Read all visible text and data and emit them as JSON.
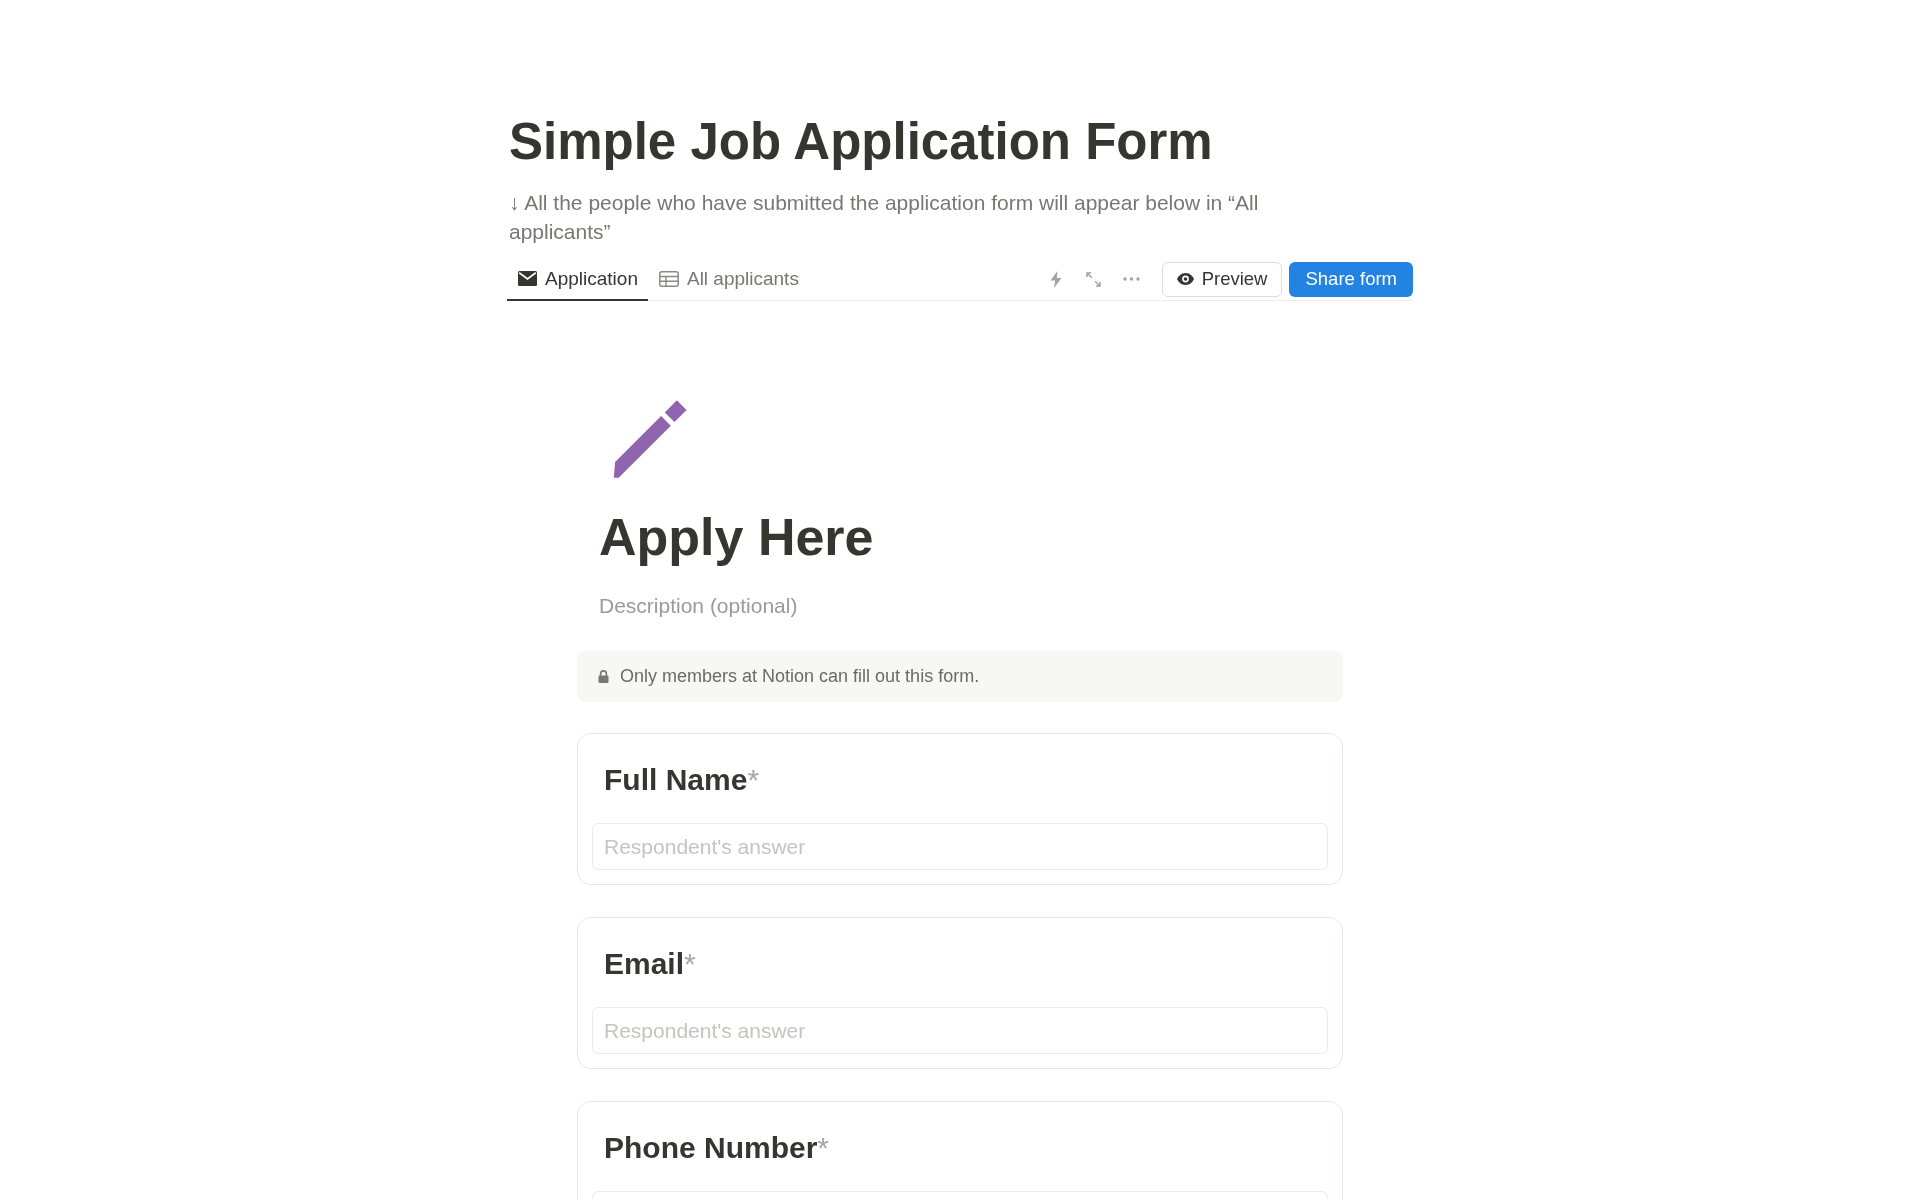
{
  "page": {
    "title": "Simple Job Application Form",
    "description": "↓ All the people who have submitted the application form will appear below in “All applicants”"
  },
  "tabs": [
    {
      "label": "Application",
      "kind": "form",
      "selected": true
    },
    {
      "label": "All applicants",
      "kind": "table",
      "selected": false
    }
  ],
  "actions": [
    {
      "label": "Preview",
      "kind": "preview"
    },
    {
      "label": "Share form",
      "kind": "share"
    }
  ],
  "form": {
    "title": "Apply Here",
    "description": {
      "placeholder": "Description (optional)"
    },
    "notice": "Only members at Notion can fill out this form.",
    "questions": [
      {
        "label": "Full Name",
        "required_mark": "*",
        "answer": {
          "placeholder": "Respondent's answer"
        }
      },
      {
        "label": "Email",
        "required_mark": "*",
        "answer": {
          "placeholder": "Respondent's answer"
        }
      },
      {
        "label": "Phone Number",
        "required_mark": "*"
      }
    ]
  }
}
